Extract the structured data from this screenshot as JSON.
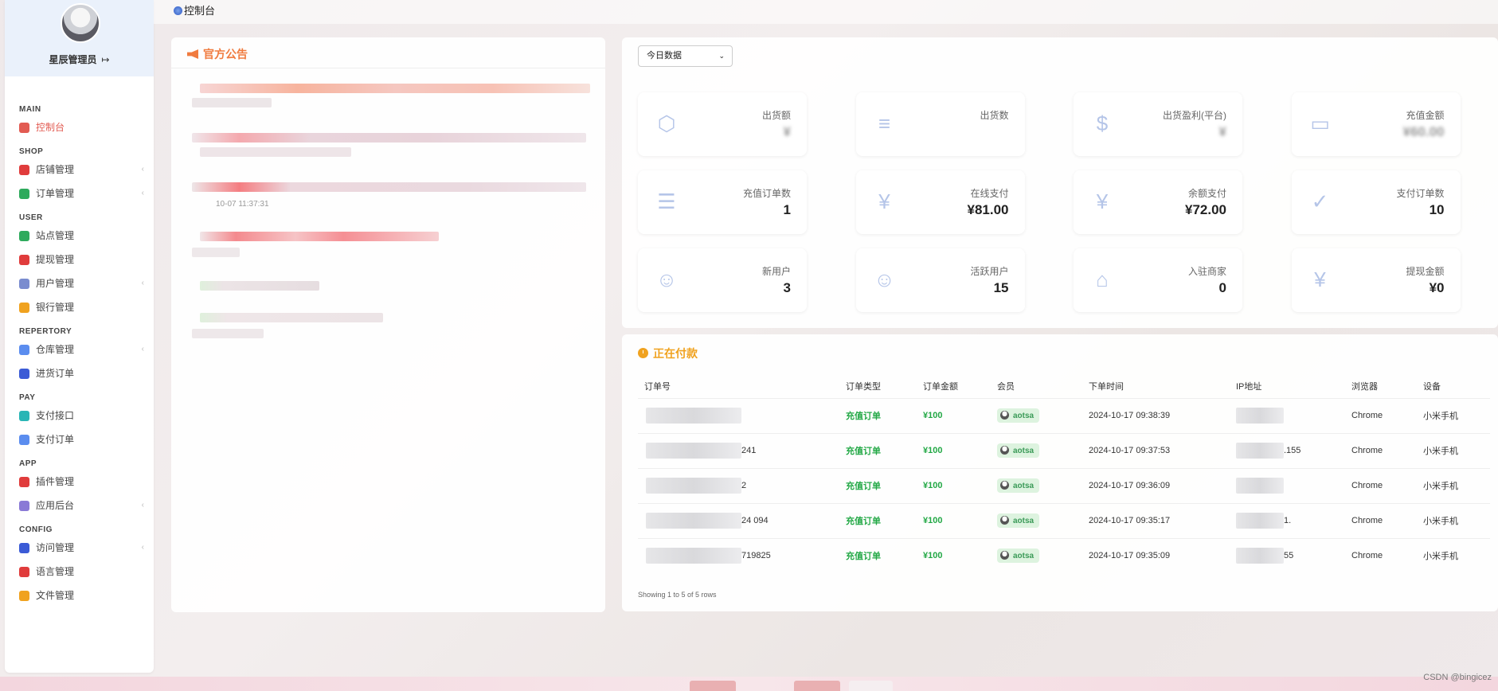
{
  "profile": {
    "name": "星辰管理员",
    "logout_icon": "logout-icon"
  },
  "breadcrumb": "控制台",
  "sidebar": {
    "groups": [
      {
        "title": "MAIN",
        "items": [
          {
            "label": "控制台",
            "icon": "dashboard-icon",
            "color": "#e25b52",
            "active": true,
            "chevron": false
          }
        ]
      },
      {
        "title": "SHOP",
        "items": [
          {
            "label": "店铺管理",
            "icon": "store-icon",
            "color": "#e03c3c",
            "chevron": true
          },
          {
            "label": "订单管理",
            "icon": "order-icon",
            "color": "#2eaa5c",
            "chevron": true
          }
        ]
      },
      {
        "title": "USER",
        "items": [
          {
            "label": "站点管理",
            "icon": "site-icon",
            "color": "#2eaa5c",
            "chevron": false
          },
          {
            "label": "提现管理",
            "icon": "withdraw-icon",
            "color": "#e03c3c",
            "chevron": false
          },
          {
            "label": "用户管理",
            "icon": "user-icon",
            "color": "#7a8ccf",
            "chevron": true
          },
          {
            "label": "银行管理",
            "icon": "bank-icon",
            "color": "#f0a21f",
            "chevron": false
          }
        ]
      },
      {
        "title": "REPERTORY",
        "items": [
          {
            "label": "仓库管理",
            "icon": "warehouse-icon",
            "color": "#5b8def",
            "chevron": true
          },
          {
            "label": "进货订单",
            "icon": "purchase-icon",
            "color": "#3b5bd6",
            "chevron": false
          }
        ]
      },
      {
        "title": "PAY",
        "items": [
          {
            "label": "支付接口",
            "icon": "pay-api-icon",
            "color": "#29b5b5",
            "chevron": false
          },
          {
            "label": "支付订单",
            "icon": "pay-order-icon",
            "color": "#5b8def",
            "chevron": false
          }
        ]
      },
      {
        "title": "APP",
        "items": [
          {
            "label": "插件管理",
            "icon": "plugin-icon",
            "color": "#e03c3c",
            "chevron": false
          },
          {
            "label": "应用后台",
            "icon": "app-icon",
            "color": "#8a7ad6",
            "chevron": true
          }
        ]
      },
      {
        "title": "CONFIG",
        "items": [
          {
            "label": "访问管理",
            "icon": "access-icon",
            "color": "#3b5bd6",
            "chevron": true
          },
          {
            "label": "语言管理",
            "icon": "language-icon",
            "color": "#e03c3c",
            "chevron": false
          },
          {
            "label": "文件管理",
            "icon": "file-icon",
            "color": "#f0a21f",
            "chevron": false
          }
        ]
      }
    ]
  },
  "announcement": {
    "title": "官方公告",
    "dates": [
      "10-07 11:37:31"
    ]
  },
  "stats": {
    "range_select": "今日数据",
    "cards": [
      {
        "label": "出货额",
        "value": "¥",
        "icon": "box-icon",
        "masked": true
      },
      {
        "label": "出货数",
        "value": "",
        "icon": "doc-icon",
        "masked": true
      },
      {
        "label": "出货盈利(平台)",
        "value": "¥",
        "icon": "profit-icon",
        "masked": true
      },
      {
        "label": "充值金额",
        "value": "¥60.00",
        "icon": "card-icon",
        "masked": true
      },
      {
        "label": "充值订单数",
        "value": "1",
        "icon": "recharge-order-icon",
        "masked": false
      },
      {
        "label": "在线支付",
        "value": "¥81.00",
        "icon": "online-pay-icon",
        "masked": false
      },
      {
        "label": "余额支付",
        "value": "¥72.00",
        "icon": "balance-pay-icon",
        "masked": false
      },
      {
        "label": "支付订单数",
        "value": "10",
        "icon": "pay-count-icon",
        "masked": false
      },
      {
        "label": "新用户",
        "value": "3",
        "icon": "new-user-icon",
        "masked": false
      },
      {
        "label": "活跃用户",
        "value": "15",
        "icon": "active-user-icon",
        "masked": false
      },
      {
        "label": "入驻商家",
        "value": "0",
        "icon": "merchant-icon",
        "masked": false
      },
      {
        "label": "提现金额",
        "value": "¥0",
        "icon": "withdraw-bag-icon",
        "masked": false
      }
    ]
  },
  "payments": {
    "title": "正在付款",
    "columns": [
      "订单号",
      "订单类型",
      "订单金额",
      "会员",
      "下单时间",
      "IP地址",
      "浏览器",
      "设备"
    ],
    "rows": [
      {
        "order_no": "",
        "type": "充值订单",
        "amount": "¥100",
        "member": "aotsa",
        "time": "2024-10-17 09:38:39",
        "ip": "",
        "browser": "Chrome",
        "device": "小米手机"
      },
      {
        "order_no": "241",
        "type": "充值订单",
        "amount": "¥100",
        "member": "aotsa",
        "time": "2024-10-17 09:37:53",
        "ip": ".155",
        "browser": "Chrome",
        "device": "小米手机"
      },
      {
        "order_no": "2",
        "type": "充值订单",
        "amount": "¥100",
        "member": "aotsa",
        "time": "2024-10-17 09:36:09",
        "ip": "",
        "browser": "Chrome",
        "device": "小米手机"
      },
      {
        "order_no": "24 094",
        "type": "充值订单",
        "amount": "¥100",
        "member": "aotsa",
        "time": "2024-10-17 09:35:17",
        "ip": "1.",
        "browser": "Chrome",
        "device": "小米手机"
      },
      {
        "order_no": "719825",
        "type": "充值订单",
        "amount": "¥100",
        "member": "aotsa",
        "time": "2024-10-17 09:35:09",
        "ip": "55",
        "browser": "Chrome",
        "device": "小米手机"
      }
    ],
    "footer": "Showing 1 to 5 of 5 rows"
  },
  "watermark": "CSDN @bingicez"
}
